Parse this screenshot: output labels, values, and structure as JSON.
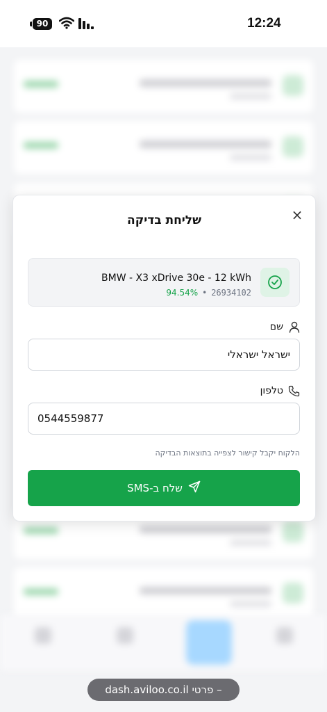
{
  "status_bar": {
    "battery": "90",
    "time": "12:24"
  },
  "modal": {
    "title": "שליחת בדיקה",
    "close_label": "×",
    "vehicle": {
      "name": "BMW - X3 xDrive 30e - 12 kWh",
      "soh": "94.54%",
      "separator": "•",
      "id": "26934102"
    },
    "name_field": {
      "label": "שם",
      "value": "ישראל ישראלי"
    },
    "phone_field": {
      "label": "טלפון",
      "value": "0544559877"
    },
    "hint": "הלקוח יקבל קישור לצפייה בתוצאות הבדיקה",
    "send_label": "שלח ב-SMS"
  },
  "url_bar": {
    "text": "dash.aviloo.co.il פרטי –"
  },
  "colors": {
    "accent": "#16a34a",
    "accent_light": "#dff3e6"
  }
}
